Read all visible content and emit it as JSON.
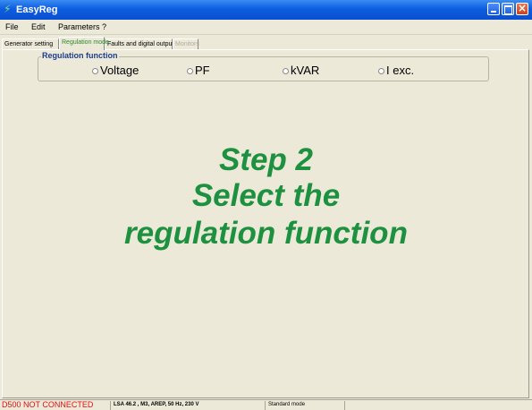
{
  "window": {
    "title": "EasyReg"
  },
  "menu": {
    "items": [
      "File",
      "Edit",
      "Parameters",
      "?"
    ]
  },
  "tabs": [
    {
      "label": "Generator setting",
      "state": "normal"
    },
    {
      "label": "Regulation mode",
      "state": "active"
    },
    {
      "label": "Faults and digital outputs",
      "state": "normal"
    },
    {
      "label": "Monitors",
      "state": "disabled"
    }
  ],
  "regulation": {
    "legend": "Regulation function",
    "options": [
      "Voltage",
      "PF",
      "kVAR",
      "I exc."
    ]
  },
  "instruction": {
    "line1": "Step 2",
    "line2": "Select the",
    "line3": "regulation function"
  },
  "status": {
    "connection": "D500 NOT CONNECTED",
    "model": "LSA 46.2 , M3, AREP, 50 Hz, 230 V",
    "mode": "Standard mode"
  },
  "colors": {
    "accent_green": "#1e9140",
    "status_red": "#e01010",
    "titlebar_blue": "#0d5de0"
  }
}
